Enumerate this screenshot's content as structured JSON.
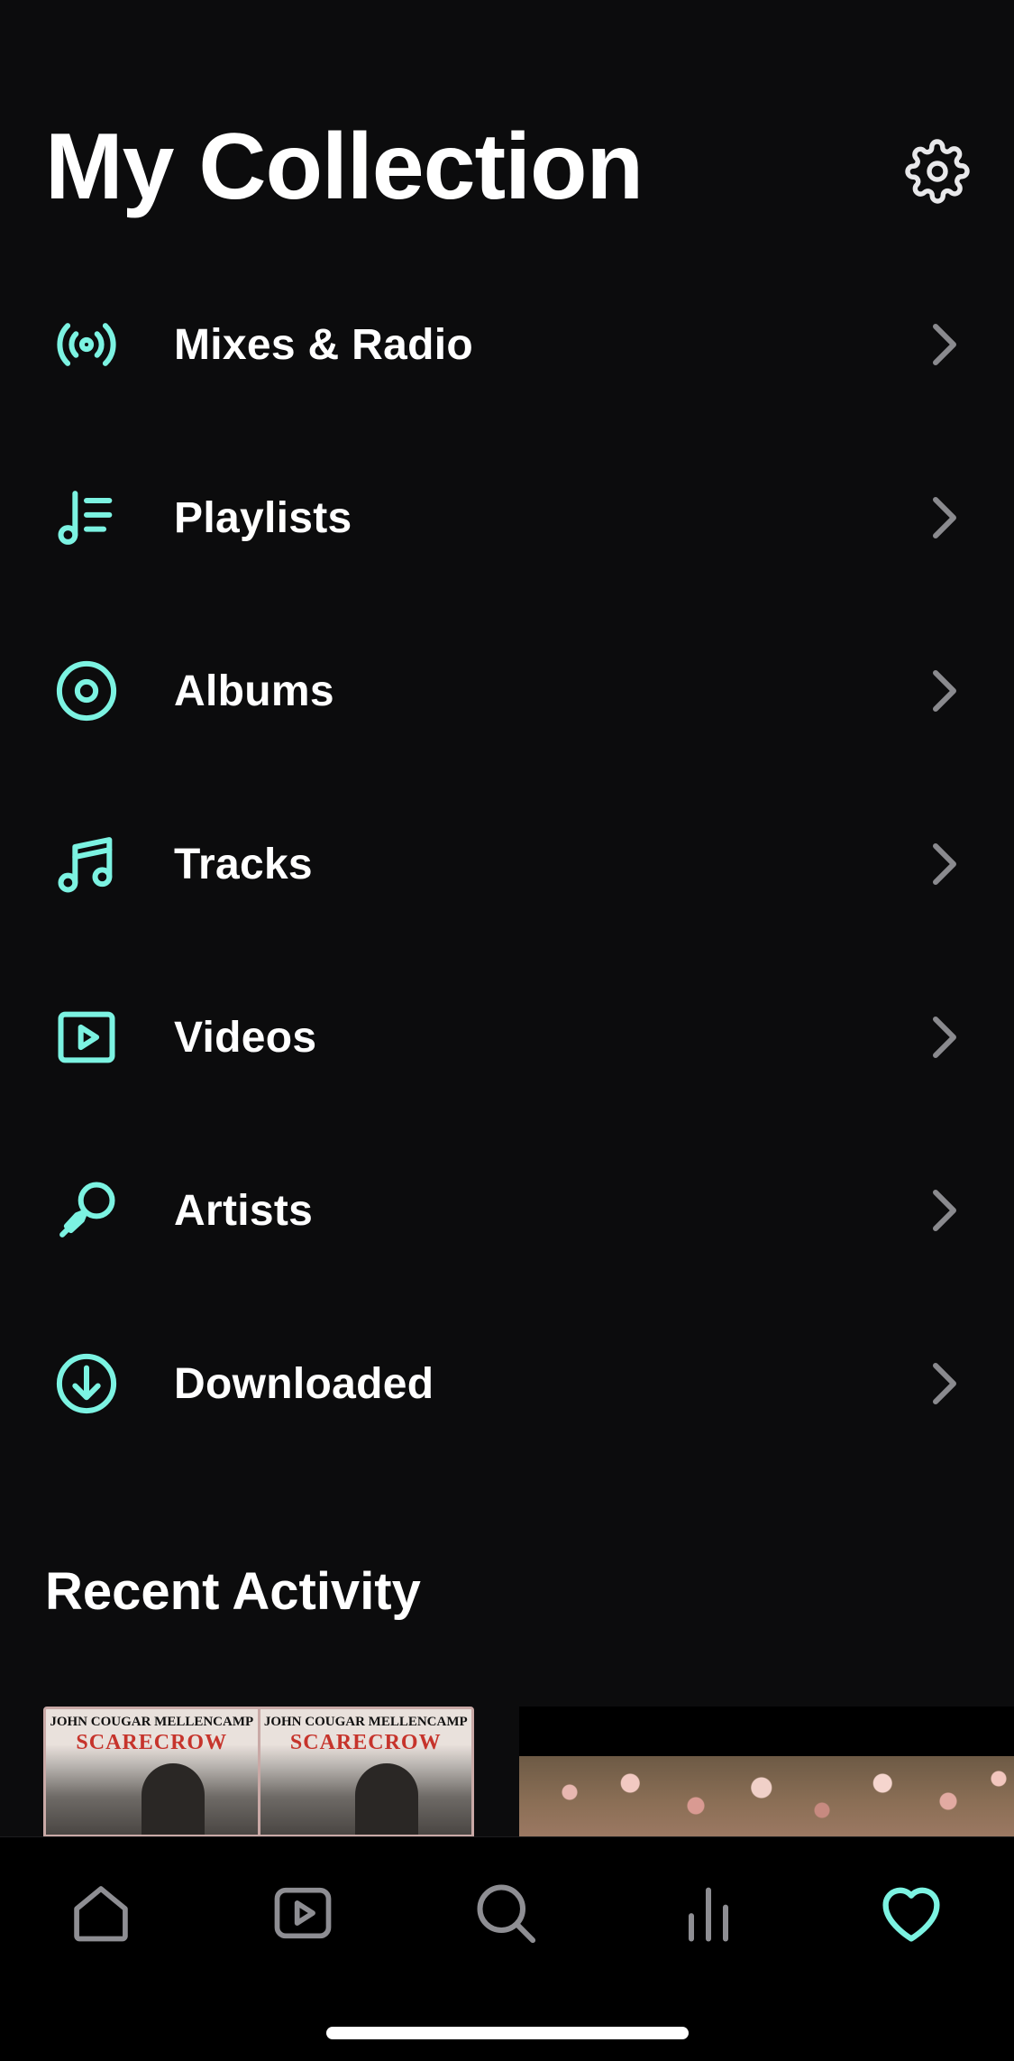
{
  "header": {
    "title": "My Collection",
    "settings_icon": "gear-icon"
  },
  "menu": {
    "items": [
      {
        "label": "Mixes & Radio",
        "icon": "radio-broadcast-icon"
      },
      {
        "label": "Playlists",
        "icon": "playlist-icon"
      },
      {
        "label": "Albums",
        "icon": "album-disc-icon"
      },
      {
        "label": "Tracks",
        "icon": "music-note-icon"
      },
      {
        "label": "Videos",
        "icon": "video-play-icon"
      },
      {
        "label": "Artists",
        "icon": "microphone-icon"
      },
      {
        "label": "Downloaded",
        "icon": "download-icon"
      }
    ]
  },
  "recent": {
    "title": "Recent Activity",
    "cards": [
      {
        "artist": "JOHN COUGAR MELLENCAMP",
        "album": "SCARECROW"
      },
      {
        "artist": "JOHN COUGAR MELLENCAMP",
        "album": "SCARECROW"
      }
    ]
  },
  "tabbar": {
    "tabs": [
      "home-icon",
      "video-icon",
      "search-icon",
      "stats-icon",
      "heart-icon"
    ],
    "active": "heart-icon"
  },
  "colors": {
    "accent": "#7cf3e2",
    "background": "#0c0c0d",
    "tabbar_bg": "#000000",
    "chevron": "#8a8a8e",
    "tab_inactive": "#8e8e93"
  }
}
